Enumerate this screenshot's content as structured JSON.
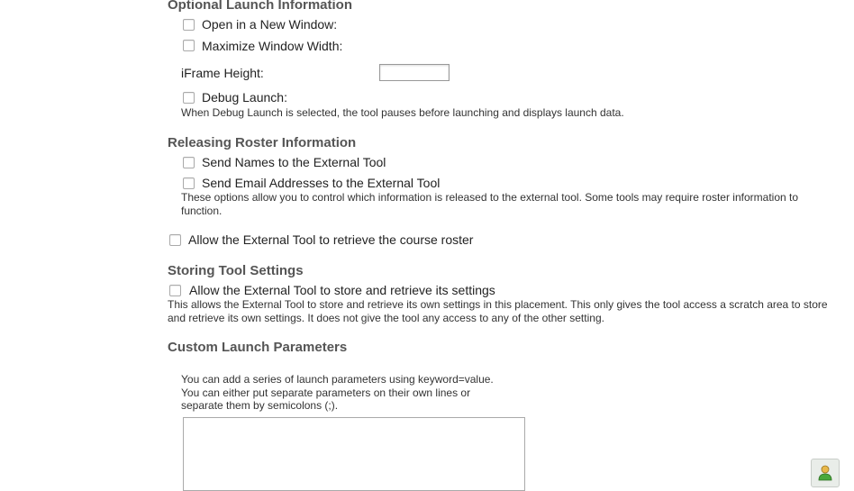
{
  "optional_launch": {
    "heading": "Optional Launch Information",
    "new_window_label": "Open in a New Window:",
    "maximize_label": "Maximize Window Width:",
    "iframe_height_label": "iFrame Height:",
    "iframe_height_value": "",
    "debug_label": "Debug Launch:",
    "debug_note": "When Debug Launch is selected, the tool pauses before launching and displays launch data."
  },
  "releasing_roster": {
    "heading": "Releasing Roster Information",
    "send_names_label": "Send Names to the External Tool",
    "send_emails_label": "Send Email Addresses to the External Tool",
    "note_line1": "These options allow you to control which information is released to the external tool. Some tools may require roster information to",
    "note_line2": "function.",
    "allow_roster_label": "Allow the External Tool to retrieve the course roster"
  },
  "storing_settings": {
    "heading": "Storing Tool Settings",
    "allow_settings_label": "Allow the External Tool to store and retrieve its settings",
    "note_line1": "This allows the External Tool to store and retrieve its own settings in this placement. This only gives the tool access a scratch area to store",
    "note_line2": "and retrieve its own settings. It does not give the tool any access to any of the other setting."
  },
  "custom_params": {
    "heading": "Custom Launch Parameters",
    "help_line1": "You can add a series of launch parameters using keyword=value.",
    "help_line2": "You can either put separate parameters on their own lines or",
    "help_line3": "separate them by semicolons (;).",
    "value": ""
  },
  "corner_button": {
    "icon": "user-help-icon"
  }
}
